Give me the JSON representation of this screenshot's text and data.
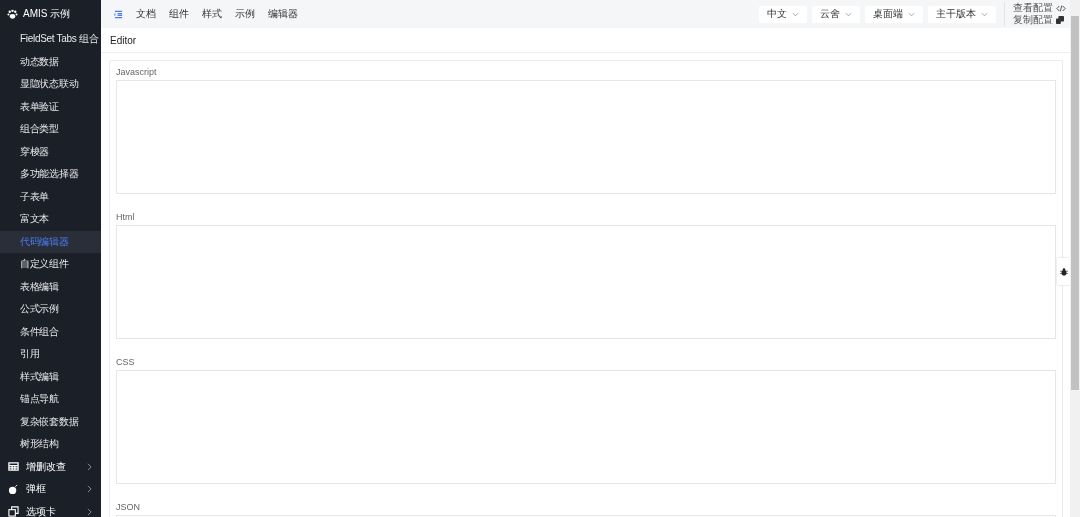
{
  "sidebar": {
    "title": "AMIS 示例",
    "items": [
      {
        "label": "FieldSet Tabs 组合",
        "selected": false
      },
      {
        "label": "动态数据",
        "selected": false
      },
      {
        "label": "显隐状态联动",
        "selected": false
      },
      {
        "label": "表单验证",
        "selected": false
      },
      {
        "label": "组合类型",
        "selected": false
      },
      {
        "label": "穿梭器",
        "selected": false
      },
      {
        "label": "多功能选择器",
        "selected": false
      },
      {
        "label": "子表单",
        "selected": false
      },
      {
        "label": "富文本",
        "selected": false
      },
      {
        "label": "代码编辑器",
        "selected": true
      },
      {
        "label": "自定义组件",
        "selected": false
      },
      {
        "label": "表格编辑",
        "selected": false
      },
      {
        "label": "公式示例",
        "selected": false
      },
      {
        "label": "条件组合",
        "selected": false
      },
      {
        "label": "引用",
        "selected": false
      },
      {
        "label": "样式编辑",
        "selected": false
      },
      {
        "label": "锚点导航",
        "selected": false
      },
      {
        "label": "复杂嵌套数据",
        "selected": false
      },
      {
        "label": "树形结构",
        "selected": false
      }
    ],
    "groups": [
      {
        "label": "增删改查",
        "kind": "table"
      },
      {
        "label": "弹框",
        "kind": "bomb"
      },
      {
        "label": "选项卡",
        "kind": "tabs"
      }
    ]
  },
  "topnav": {
    "links": [
      "文档",
      "组件",
      "样式",
      "示例",
      "编辑器"
    ],
    "selects": [
      "中文",
      "云舍",
      "桌面端",
      "主干版本"
    ],
    "view_config": "查看配置",
    "copy_config": "复制配置"
  },
  "page": {
    "title": "Editor",
    "fields": [
      "Javascript",
      "Html",
      "CSS",
      "JSON"
    ]
  }
}
